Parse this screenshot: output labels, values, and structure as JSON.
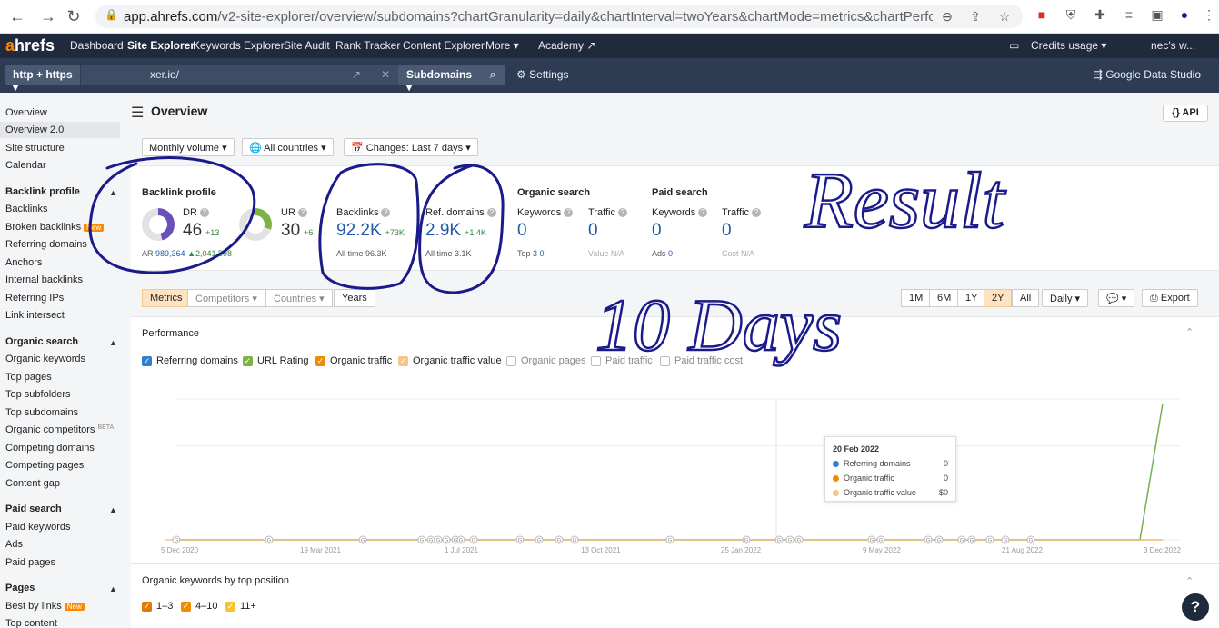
{
  "browser": {
    "url_host": "app.ahrefs.com",
    "url_path": "/v2-site-explorer/overview/subdomains?chartGranularity=daily&chartInterval=twoYears&chartMode=metrics&chartPerforman..."
  },
  "topnav": {
    "logo_a": "a",
    "logo_rest": "hrefs",
    "items": [
      "Dashboard",
      "Site Explorer",
      "Keywords Explorer",
      "Site Audit",
      "Rank Tracker",
      "Content Explorer",
      "More ▾",
      "Academy ↗"
    ],
    "credits": "Credits usage ▾",
    "account": "nec's w..."
  },
  "search": {
    "protocol": "http + https ▾",
    "target": "xer.io/",
    "mode": "Subdomains ▾",
    "settings": "Settings",
    "gds": "Google Data Studio"
  },
  "sidebar": {
    "items_top": [
      "Overview",
      "Overview 2.0",
      "Site structure",
      "Calendar"
    ],
    "backlink_head": "Backlink profile",
    "backlink_items": [
      "Backlinks",
      "Broken backlinks",
      "Referring domains",
      "Anchors",
      "Internal backlinks",
      "Referring IPs",
      "Link intersect"
    ],
    "organic_head": "Organic search",
    "organic_items": [
      "Organic keywords",
      "Top pages",
      "Top subfolders",
      "Top subdomains",
      "Organic competitors",
      "Competing domains",
      "Competing pages",
      "Content gap"
    ],
    "paid_head": "Paid search",
    "paid_items": [
      "Paid keywords",
      "Ads",
      "Paid pages"
    ],
    "pages_head": "Pages",
    "pages_items": [
      "Best by links",
      "Top content"
    ],
    "new_badge": "New",
    "beta_badge": "BETA"
  },
  "main": {
    "title": "Overview",
    "api": "{} API",
    "filters": [
      "Monthly volume ▾",
      "🌐 All countries ▾",
      "📅 Changes: Last 7 days ▾"
    ]
  },
  "metrics": {
    "backlink_profile": "Backlink profile",
    "dr_label": "DR",
    "dr_value": "46",
    "dr_delta": "+13",
    "ar_label": "AR",
    "ar_value": "989,364",
    "ar_delta": "▲2,041,598",
    "ur_label": "UR",
    "ur_value": "30",
    "ur_delta": "+6",
    "backlinks_label": "Backlinks",
    "backlinks_value": "92.2K",
    "backlinks_delta": "+73K",
    "backlinks_all": "All time",
    "backlinks_all_value": "96.3K",
    "refdomains_label": "Ref. domains",
    "refdomains_value": "2.9K",
    "refdomains_delta": "+1.4K",
    "refdomains_all": "All time",
    "refdomains_all_value": "3.1K",
    "organic_head": "Organic search",
    "org_kw_label": "Keywords",
    "org_kw_value": "0",
    "org_top3": "Top 3",
    "org_top3_value": "0",
    "org_traffic_label": "Traffic",
    "org_traffic_value": "0",
    "org_value_label": "Value",
    "org_value_value": "N/A",
    "paid_head": "Paid search",
    "paid_kw_label": "Keywords",
    "paid_kw_value": "0",
    "paid_ads": "Ads",
    "paid_ads_value": "0",
    "paid_traffic_label": "Traffic",
    "paid_traffic_value": "0",
    "paid_cost_label": "Cost",
    "paid_cost_value": "N/A"
  },
  "tabs": {
    "left": [
      "Metrics",
      "Competitors ▾",
      "Countries ▾",
      "Years"
    ],
    "ranges": [
      "1M",
      "6M",
      "1Y",
      "2Y",
      "All"
    ],
    "granularity": "Daily ▾",
    "annotate": "💬 ▾",
    "export": "Export"
  },
  "performance": {
    "title": "Performance",
    "legend": [
      {
        "label": "Referring domains",
        "checked": true,
        "color": "#2f7fd1"
      },
      {
        "label": "URL Rating",
        "checked": true,
        "color": "#7cb342"
      },
      {
        "label": "Organic traffic",
        "checked": true,
        "color": "#f08c00"
      },
      {
        "label": "Organic traffic value",
        "checked": true,
        "color": "#f6c58a"
      },
      {
        "label": "Organic pages",
        "checked": false,
        "color": "#bbbbbb"
      },
      {
        "label": "Paid traffic",
        "checked": false,
        "color": "#bbbbbb"
      },
      {
        "label": "Paid traffic cost",
        "checked": false,
        "color": "#bbbbbb"
      }
    ],
    "x_labels": [
      "5 Dec 2020",
      "19 Mar 2021",
      "1 Jul 2021",
      "13 Oct 2021",
      "25 Jan 2022",
      "9 May 2022",
      "21 Aug 2022",
      "3 Dec 2022"
    ],
    "tooltip": {
      "date": "20 Feb 2022",
      "rows": [
        {
          "label": "Referring domains",
          "value": "0",
          "color": "#2f7fd1"
        },
        {
          "label": "Organic traffic",
          "value": "0",
          "color": "#f08c00"
        },
        {
          "label": "Organic traffic value",
          "value": "$0",
          "color": "#f6c58a"
        }
      ]
    },
    "marker": "G"
  },
  "keywords": {
    "title": "Organic keywords by top position",
    "legend": [
      {
        "label": "1–3",
        "color": "#e07b00"
      },
      {
        "label": "4–10",
        "color": "#f08c00"
      },
      {
        "label": "11+",
        "color": "#f7c32e"
      }
    ]
  },
  "chart_data": {
    "type": "line",
    "x": [
      "5 Dec 2020",
      "19 Mar 2021",
      "1 Jul 2021",
      "13 Oct 2021",
      "25 Jan 2022",
      "9 May 2022",
      "21 Aug 2022",
      "3 Dec 2022"
    ],
    "series": [
      {
        "name": "Referring domains",
        "values": [
          0,
          0,
          0,
          0,
          0,
          0,
          0,
          2900
        ]
      },
      {
        "name": "URL Rating",
        "values": [
          0,
          0,
          0,
          0,
          0,
          0,
          0,
          30
        ]
      },
      {
        "name": "Organic traffic",
        "values": [
          0,
          0,
          0,
          0,
          0,
          0,
          0,
          0
        ]
      },
      {
        "name": "Organic traffic value",
        "values": [
          0,
          0,
          0,
          0,
          0,
          0,
          0,
          0
        ]
      }
    ]
  },
  "annotation": {
    "line1": "Result",
    "line2": "10 Days"
  },
  "help": "?"
}
